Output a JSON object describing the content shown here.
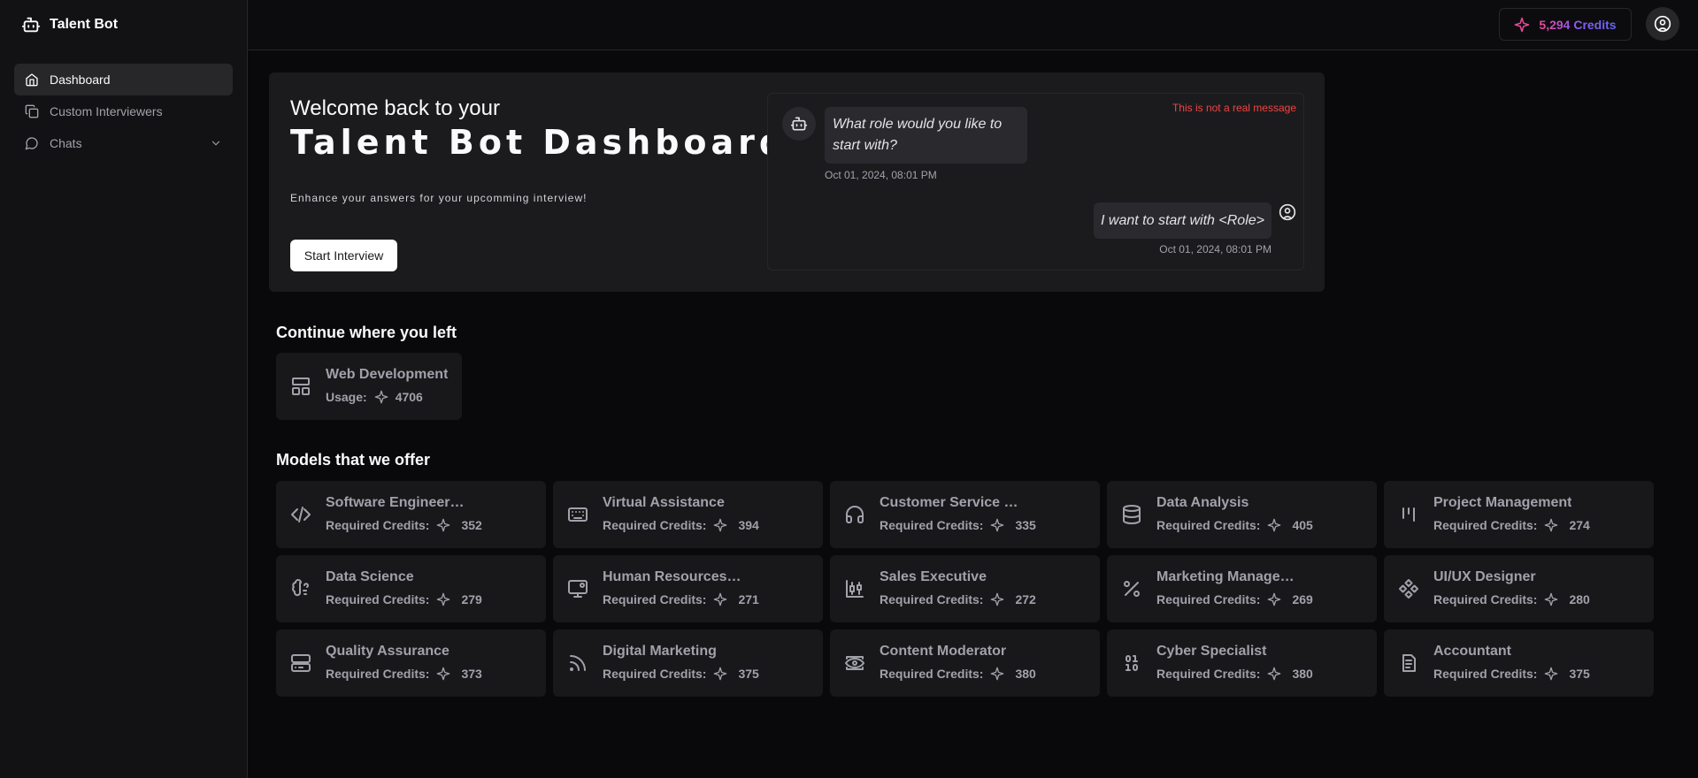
{
  "app": {
    "name": "Talent Bot"
  },
  "sidebar": {
    "items": [
      {
        "label": "Dashboard",
        "icon": "home-icon",
        "active": true
      },
      {
        "label": "Custom Interviewers",
        "icon": "copy-icon"
      },
      {
        "label": "Chats",
        "icon": "message-circle-icon",
        "expandable": true
      }
    ]
  },
  "topbar": {
    "credits_label": "5,294 Credits",
    "avatar_icon": "user-circle-icon"
  },
  "hero": {
    "subtitle": "Welcome back to your",
    "title": "Talent Bot Dashboard",
    "description": "Enhance your answers for your upcomming interview!",
    "button_label": "Start Interview",
    "chat": {
      "disclaimer": "This is not a real message",
      "bot_message": "What role would you like to start with?",
      "bot_timestamp": "Oct 01, 2024, 08:01 PM",
      "user_message": "I want to start with <Role>",
      "user_timestamp": "Oct 01, 2024, 08:01 PM"
    }
  },
  "continue": {
    "title": "Continue where you left",
    "card": {
      "title": "Web Development",
      "usage_label": "Usage:",
      "usage_value": "4706",
      "icon": "layout-icon"
    }
  },
  "models": {
    "title": "Models that we offer",
    "credits_label": "Required Credits:",
    "items": [
      {
        "title": "Software Engineering",
        "credits": "352",
        "icon": "code-icon"
      },
      {
        "title": "Virtual Assistance",
        "credits": "394",
        "icon": "keyboard-icon"
      },
      {
        "title": "Customer Service Representative",
        "credits": "335",
        "icon": "headphones-icon"
      },
      {
        "title": "Data Analysis",
        "credits": "405",
        "icon": "database-icon"
      },
      {
        "title": "Project Management",
        "credits": "274",
        "icon": "kanban-icon"
      },
      {
        "title": "Data Science",
        "credits": "279",
        "icon": "brain-icon"
      },
      {
        "title": "Human Resources Manager",
        "credits": "271",
        "icon": "monitor-user-icon"
      },
      {
        "title": "Sales Executive",
        "credits": "272",
        "icon": "chart-candlestick-icon"
      },
      {
        "title": "Marketing Management",
        "credits": "269",
        "icon": "percent-icon"
      },
      {
        "title": "UI/UX Designer",
        "credits": "280",
        "icon": "component-icon"
      },
      {
        "title": "Quality Assurance",
        "credits": "373",
        "icon": "server-icon"
      },
      {
        "title": "Digital Marketing",
        "credits": "375",
        "icon": "rss-icon"
      },
      {
        "title": "Content Moderator",
        "credits": "380",
        "icon": "eye-box-icon"
      },
      {
        "title": "Cyber Specialist",
        "credits": "380",
        "icon": "binary-icon"
      },
      {
        "title": "Accountant",
        "credits": "375",
        "icon": "file-text-icon"
      }
    ]
  },
  "colors": {
    "background": "#09090b",
    "sidebar": "#121214",
    "card": "#18181b",
    "accent_pink": "#ec4899",
    "accent_indigo": "#6366f1",
    "warning": "#ef4444"
  }
}
